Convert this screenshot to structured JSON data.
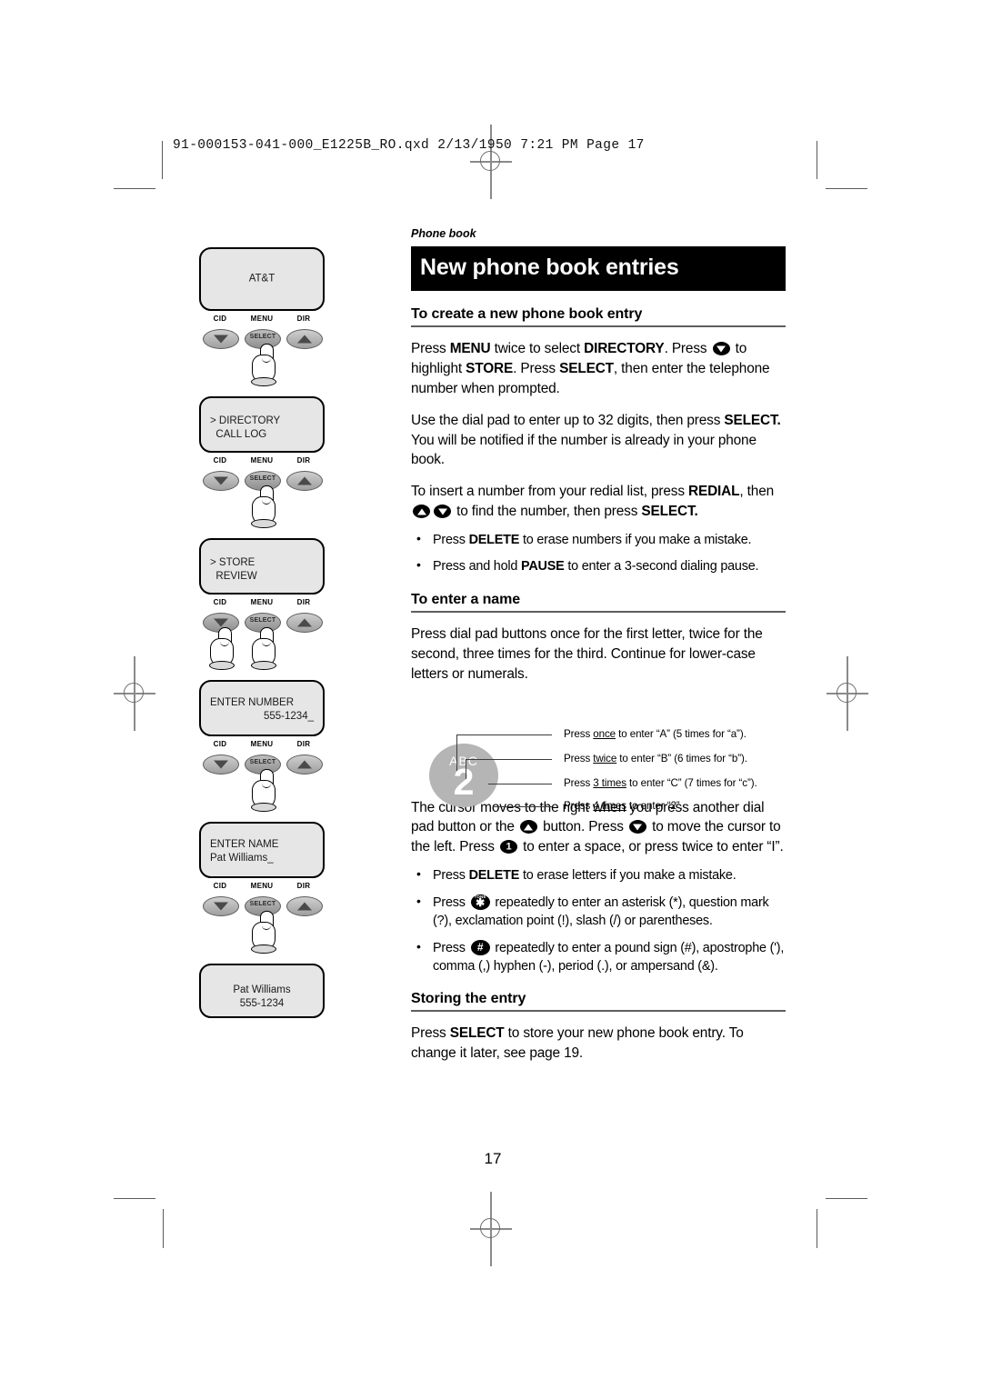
{
  "file_header": "91-000153-041-000_E1225B_RO.qxd  2/13/1950  7:21 PM  Page 17",
  "kicker": "Phone book",
  "title": "New phone book entries",
  "page_number": "17",
  "sections": [
    {
      "heading": "To create a new phone book entry",
      "paragraphs": [
        "Press MENU twice to select DIRECTORY. Press [down] to highlight STORE. Press SELECT, then enter the telephone number when prompted.",
        "Use the dial pad to enter up to 32 digits, then press SELECT. You will be notified if the number is already in your phone book.",
        "To insert a number from your redial list, press REDIAL, then [up][down] to find the number, then press SELECT."
      ],
      "bullets": [
        "Press DELETE to erase numbers if you make a mistake.",
        "Press and hold PAUSE to enter a 3-second dialing pause."
      ]
    },
    {
      "heading": "To enter a name",
      "paragraphs": [
        "Press dial pad buttons once for the first letter, twice for the second, three times for the third. Continue for lower-case letters or numerals.",
        "The cursor moves to the right when you press another dial pad button or the [up] button. Press [down] to move the cursor to the left. Press [1] to enter a space, or press twice to enter “I”."
      ],
      "bullets": [
        "Press DELETE to erase letters if you make a mistake.",
        "Press [star] repeatedly to enter an asterisk (*), question mark (?), exclamation point (!), slash (/) or parentheses.",
        "Press [pound] repeatedly to enter a pound sign (#), apostrophe ('), comma (,) hyphen (-), period (.), or ampersand (&)."
      ]
    },
    {
      "heading": "Storing the entry",
      "paragraphs": [
        "Press SELECT to store your new phone book entry. To change it later, see page 19."
      ],
      "bullets": []
    }
  ],
  "para": {
    "p1_a": "Press ",
    "p1_menu": "MENU",
    "p1_b": " twice to select ",
    "p1_dir": "DIRECTORY",
    "p1_c": ". Press ",
    "p1_d": " to highlight ",
    "p1_store": "STORE",
    "p1_e": ". Press ",
    "p1_select": "SELECT",
    "p1_f": ", then enter the telephone number when prompted.",
    "p2_a": "Use the dial pad to enter up to 32 digits, then press ",
    "p2_select": "SELECT.",
    "p2_b": " You will be notified if the number is already in your phone book.",
    "p3_a": "To insert a number from your redial list, press ",
    "p3_redial": "REDIAL",
    "p3_b": ", then ",
    "p3_c": " to find the number, then press ",
    "p3_select": "SELECT.",
    "b1_a": "Press ",
    "b1_delete": "DELETE",
    "b1_b": " to erase numbers if you make a mistake.",
    "b2_a": "Press and hold ",
    "b2_pause": "PAUSE",
    "b2_b": " to enter a 3-second dialing pause.",
    "p4": "Press dial pad buttons once for the first letter, twice for the second, three times for the third. Continue for lower-case letters or numerals.",
    "p5_a": "The cursor moves to the right when you press another dial pad button or the ",
    "p5_b": " button. Press ",
    "p5_c": " to move the cursor to the left. Press ",
    "p5_d": " to enter a space, or press twice to enter “I”.",
    "b3_a": "Press ",
    "b3_delete": "DELETE",
    "b3_b": " to erase letters if you make a mistake.",
    "b4_a": "Press ",
    "b4_b": " repeatedly to enter an asterisk (*), question mark (?), exclamation point (!), slash (/) or parentheses.",
    "b5_a": "Press ",
    "b5_b": " repeatedly to enter a pound sign (#), apostrophe ('), comma (,) hyphen (-), period (.), or ampersand (&).",
    "p6_a": "Press ",
    "p6_select": "SELECT",
    "p6_b": " to store your new phone book entry. To change it later, see page 19."
  },
  "callout": {
    "key_letters": "ABC",
    "key_digit": "2",
    "lines": [
      {
        "pre": "Press ",
        "em": "once",
        "post": " to enter “A” (5 times for “a”)."
      },
      {
        "pre": "Press ",
        "em": "twice",
        "post": " to enter “B” (6 times for “b”)."
      },
      {
        "pre": "Press ",
        "em": "3 times",
        "post": " to enter “C” (7 times for “c”)."
      },
      {
        "pre": "Press ",
        "em": "4 times",
        "post": " to enter “2”."
      }
    ]
  },
  "illustration": {
    "key_caps": {
      "cid": "CID",
      "menu": "MENU",
      "dir": "DIR",
      "select": "SELECT"
    },
    "screens": [
      {
        "name": "screen-att",
        "line1": "AT&T",
        "line2": "",
        "align": "center"
      },
      {
        "name": "screen-directory",
        "line1": "> DIRECTORY",
        "line2": "  CALL LOG",
        "align": "left"
      },
      {
        "name": "screen-store",
        "line1": "> STORE",
        "line2": "  REVIEW",
        "align": "left"
      },
      {
        "name": "screen-enter-number",
        "line1": "ENTER NUMBER",
        "line2": "555-1234_",
        "align": "num"
      },
      {
        "name": "screen-enter-name",
        "line1": "ENTER NAME",
        "line2": "Pat Williams_",
        "align": "left"
      },
      {
        "name": "screen-result",
        "line1": "Pat Williams",
        "line2": "555-1234",
        "align": "center"
      }
    ]
  }
}
